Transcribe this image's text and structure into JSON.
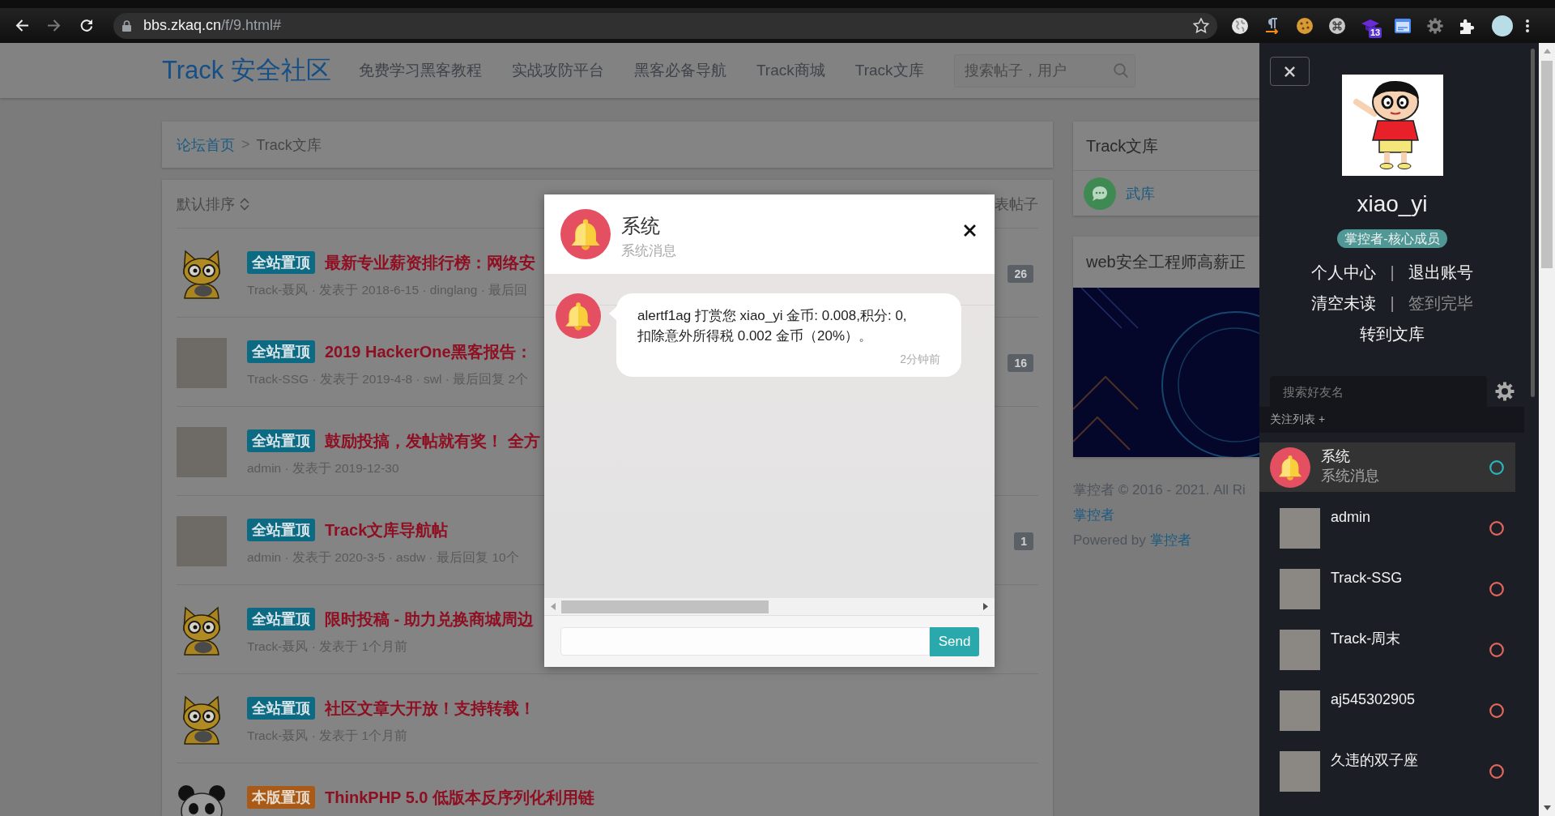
{
  "browser": {
    "url_host": "bbs.zkaq.cn",
    "url_path": "/f/9.html#",
    "extension_badge": "13"
  },
  "header": {
    "logo": "Track 安全社区",
    "nav": [
      "免费学习黑客教程",
      "实战攻防平台",
      "黑客必备导航",
      "Track商城",
      "Track文库"
    ],
    "search": {
      "placeholder": "搜索帖子，用户"
    }
  },
  "breadcrumb": {
    "items": [
      "论坛首页",
      "Track文库"
    ],
    "separator": ">"
  },
  "topic_list": {
    "sort_label": "默认排序",
    "post_button": "表帖子",
    "topics": [
      {
        "avatar": {
          "kind": "cat"
        },
        "badge": {
          "text": "全站置顶",
          "kind": "global"
        },
        "title": "最新专业薪资排行榜：网络安",
        "meta": "Track-聂风 · 发表于 2018-6-15 · dinglang · 最后回",
        "count": "26"
      },
      {
        "avatar": {
          "kind": "photo"
        },
        "badge": {
          "text": "全站置顶",
          "kind": "global"
        },
        "title": "2019 HackerOne黑客报告：",
        "meta": "Track-SSG · 发表于 2019-4-8 · swl · 最后回复 2个",
        "count": "16"
      },
      {
        "avatar": {
          "kind": "photo"
        },
        "badge": {
          "text": "全站置顶",
          "kind": "global"
        },
        "title": "鼓励投搞，发帖就有奖！ 全方",
        "meta": "admin · 发表于 2019-12-30"
      },
      {
        "avatar": {
          "kind": "photo"
        },
        "badge": {
          "text": "全站置顶",
          "kind": "global"
        },
        "title": "Track文库导航帖",
        "meta": "admin · 发表于 2020-3-5 · asdw · 最后回复 10个",
        "count": "1"
      },
      {
        "avatar": {
          "kind": "cat"
        },
        "badge": {
          "text": "全站置顶",
          "kind": "global"
        },
        "title": "限时投稿 - 助力兑换商城周边",
        "meta": "Track-聂风 · 发表于 1个月前"
      },
      {
        "avatar": {
          "kind": "cat"
        },
        "badge": {
          "text": "全站置顶",
          "kind": "global"
        },
        "title": "社区文章大开放！支持转载！",
        "meta": "Track-聂风 · 发表于 1个月前"
      },
      {
        "avatar": {
          "kind": "panda"
        },
        "badge": {
          "text": "本版置顶",
          "kind": "board"
        },
        "title": "ThinkPHP 5.0 低版本反序列化利用链"
      }
    ]
  },
  "library_card": {
    "title": "Track文库",
    "items": [
      "武库"
    ]
  },
  "promo_card": {
    "title": "web安全工程师高薪正"
  },
  "footer": {
    "copyright": "掌控者 © 2016 - 2021. All Ri",
    "owner_link": "掌控者",
    "powered_by": "Powered by",
    "powered_link": "掌控者"
  },
  "user_panel": {
    "username": "xiao_yi",
    "role": "掌控者-核心成员",
    "link_rows": [
      {
        "links": [
          {
            "label": "个人中心",
            "disabled": false
          },
          {
            "label": "退出账号",
            "disabled": false
          }
        ],
        "separator": "|"
      },
      {
        "links": [
          {
            "label": "清空未读",
            "disabled": false
          },
          {
            "label": "签到完毕",
            "disabled": true
          }
        ],
        "separator": "|"
      },
      {
        "links": [
          {
            "label": "转到文库",
            "disabled": false
          }
        ]
      }
    ],
    "search": {
      "placeholder": "搜索好友名"
    },
    "follow_label": "关注列表 +",
    "contacts": [
      {
        "name": "系统",
        "subtitle": "系统消息",
        "avatar": {
          "kind": "bell"
        },
        "selected": true,
        "color": "#2ab4bc"
      },
      {
        "name": "admin",
        "avatar": {
          "kind": "photo"
        },
        "selected": false,
        "color": "#e2665d"
      },
      {
        "name": "Track-SSG",
        "avatar": {
          "kind": "photo"
        },
        "selected": false,
        "color": "#e2665d"
      },
      {
        "name": "Track-周末",
        "avatar": {
          "kind": "photo"
        },
        "selected": false,
        "color": "#e2665d"
      },
      {
        "name": "aj545302905",
        "avatar": {
          "kind": "photo"
        },
        "selected": false,
        "color": "#e2665d"
      },
      {
        "name": "久违的双子座",
        "avatar": {
          "kind": "photo"
        },
        "selected": false,
        "color": "#e2665d"
      }
    ]
  },
  "chat_dialog": {
    "title": "系统",
    "subtitle": "系统消息",
    "messages": [
      {
        "lines": [
          "alertf1ag 打赏您 xiao_yi 金币: 0.008,积分: 0,",
          "扣除意外所得税 0.002 金币（20%）。"
        ],
        "time": "2分钟前"
      }
    ],
    "send_button": "Send"
  }
}
